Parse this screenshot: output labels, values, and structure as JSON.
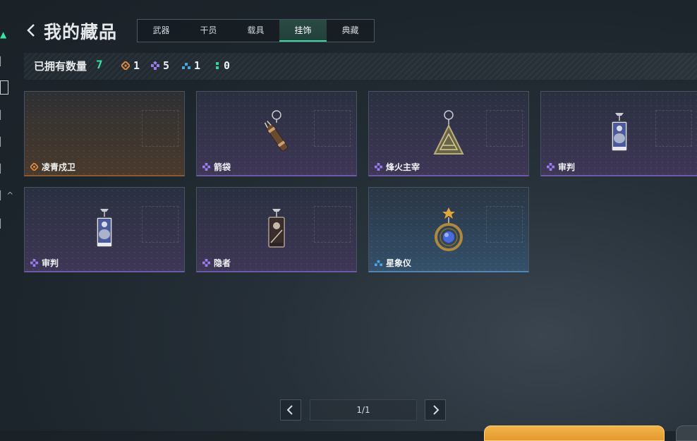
{
  "header": {
    "title": "我的藏品"
  },
  "tabs": [
    {
      "label": "武器",
      "active": false
    },
    {
      "label": "干员",
      "active": false
    },
    {
      "label": "载具",
      "active": false
    },
    {
      "label": "挂饰",
      "active": true
    },
    {
      "label": "典藏",
      "active": false
    }
  ],
  "summary": {
    "owned_label": "已拥有数量",
    "owned_count": "7",
    "rarity_counts": [
      {
        "rarity": "legendary",
        "color": "#e08a3c",
        "count": "1"
      },
      {
        "rarity": "epic",
        "color": "#9b7cf0",
        "count": "5"
      },
      {
        "rarity": "rare",
        "color": "#4aa6e0",
        "count": "1"
      },
      {
        "rarity": "uncommon",
        "color": "#36d39b",
        "count": "0"
      }
    ]
  },
  "items": [
    {
      "name": "凌青戍卫",
      "rarity": "legendary",
      "icon": "empty-slot"
    },
    {
      "name": "箭袋",
      "rarity": "epic",
      "icon": "quiver-charm-icon"
    },
    {
      "name": "烽火主宰",
      "rarity": "epic",
      "icon": "triangle-pendant-icon"
    },
    {
      "name": "审判",
      "rarity": "epic",
      "icon": "tarot-card-charm-icon"
    },
    {
      "name": "审判",
      "rarity": "epic",
      "icon": "tarot-card-charm-icon"
    },
    {
      "name": "隐者",
      "rarity": "epic",
      "icon": "tarot-card-charm-icon"
    },
    {
      "name": "星象仪",
      "rarity": "rare",
      "icon": "astrolabe-charm-icon"
    }
  ],
  "pagination": {
    "label": "1/1"
  },
  "colors": {
    "accent": "#36e3a1",
    "legendary": "#e08a3c",
    "epic": "#9b7cf0",
    "rare": "#4aa6e0"
  }
}
